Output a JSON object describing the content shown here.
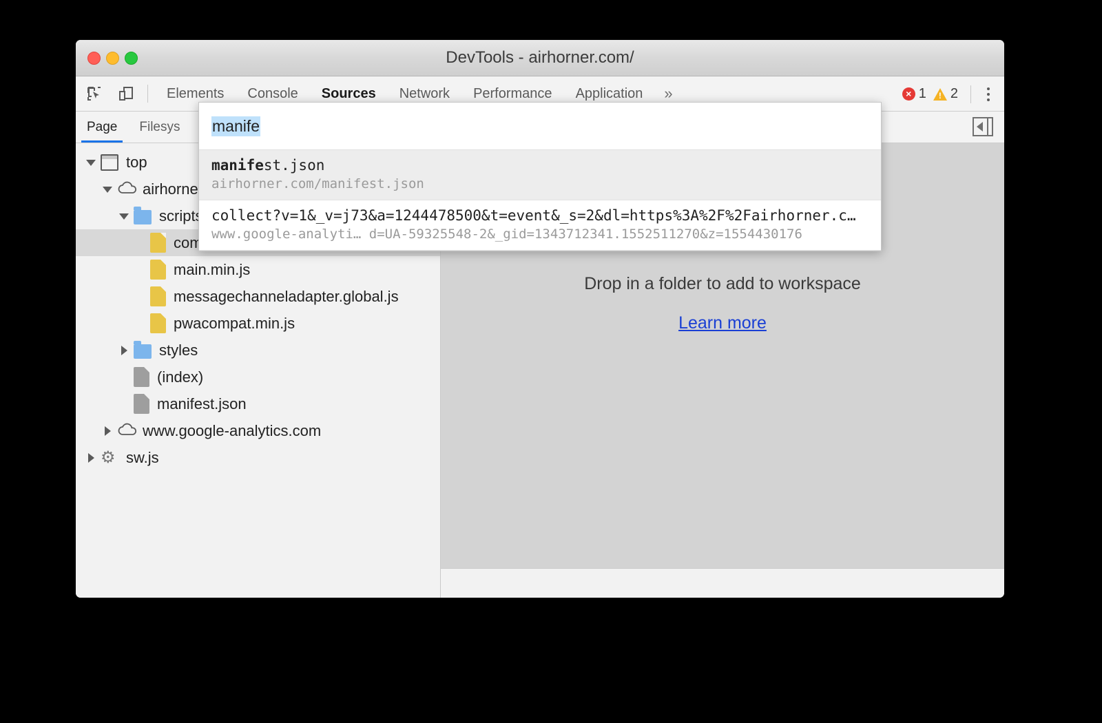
{
  "window": {
    "title": "DevTools - airhorner.com/",
    "traffic_lights": [
      "close",
      "minimize",
      "maximize"
    ]
  },
  "toolbar": {
    "inspect_icon": "inspect-element-icon",
    "device_icon": "device-toolbar-icon",
    "tabs": [
      {
        "label": "Elements",
        "active": false
      },
      {
        "label": "Console",
        "active": false
      },
      {
        "label": "Sources",
        "active": true
      },
      {
        "label": "Network",
        "active": false
      },
      {
        "label": "Performance",
        "active": false
      },
      {
        "label": "Application",
        "active": false
      }
    ],
    "more_tabs_label": "»",
    "errors": {
      "count": "1",
      "color": "#e53935"
    },
    "warnings": {
      "count": "2",
      "color": "#f5b324"
    },
    "menu_icon": "kebab-menu-icon"
  },
  "navigator": {
    "tabs": [
      {
        "label": "Page",
        "active": true
      },
      {
        "label": "Filesys",
        "active": false
      }
    ],
    "collapse_icon": "collapse-sidebar-icon",
    "tree": [
      {
        "label": "top",
        "icon": "frame",
        "twisty": "open",
        "indent": 0,
        "selected": false
      },
      {
        "label": "airhorne",
        "icon": "cloud",
        "twisty": "open",
        "indent": 1,
        "selected": false
      },
      {
        "label": "scripts",
        "icon": "folder",
        "twisty": "open",
        "indent": 2,
        "selected": false
      },
      {
        "label": "comlink.global.js",
        "icon": "jsfile",
        "twisty": "none",
        "indent": 3,
        "selected": true
      },
      {
        "label": "main.min.js",
        "icon": "jsfile",
        "twisty": "none",
        "indent": 3,
        "selected": false
      },
      {
        "label": "messagechanneladapter.global.js",
        "icon": "jsfile",
        "twisty": "none",
        "indent": 3,
        "selected": false
      },
      {
        "label": "pwacompat.min.js",
        "icon": "jsfile",
        "twisty": "none",
        "indent": 3,
        "selected": false
      },
      {
        "label": "styles",
        "icon": "folder",
        "twisty": "closed",
        "indent": 2,
        "selected": false
      },
      {
        "label": "(index)",
        "icon": "docfile",
        "twisty": "none",
        "indent": 2,
        "selected": false
      },
      {
        "label": "manifest.json",
        "icon": "docfile",
        "twisty": "none",
        "indent": 2,
        "selected": false
      },
      {
        "label": "www.google-analytics.com",
        "icon": "cloud",
        "twisty": "closed",
        "indent": 1,
        "selected": false
      },
      {
        "label": "sw.js",
        "icon": "gear",
        "twisty": "closed",
        "indent": 0,
        "selected": false
      }
    ]
  },
  "editor": {
    "drop_text": "Drop in a folder to add to workspace",
    "learn_more": "Learn more",
    "learn_more_color": "#1a3fd4"
  },
  "quick_open": {
    "query": "manife",
    "query_highlight_color": "#bfe1fb",
    "results": [
      {
        "title_match": "manife",
        "title_rest": "st.json",
        "subtitle": "airhorner.com/manifest.json",
        "selected": true
      },
      {
        "title_match": "",
        "title_rest": "collect?v=1&_v=j73&a=1244478500&t=event&_s=2&dl=https%3A%2F%2Fairhorner.c…",
        "subtitle": "www.google-analyti… d=UA-59325548-2&_gid=1343712341.1552511270&z=1554430176",
        "selected": false
      }
    ]
  }
}
